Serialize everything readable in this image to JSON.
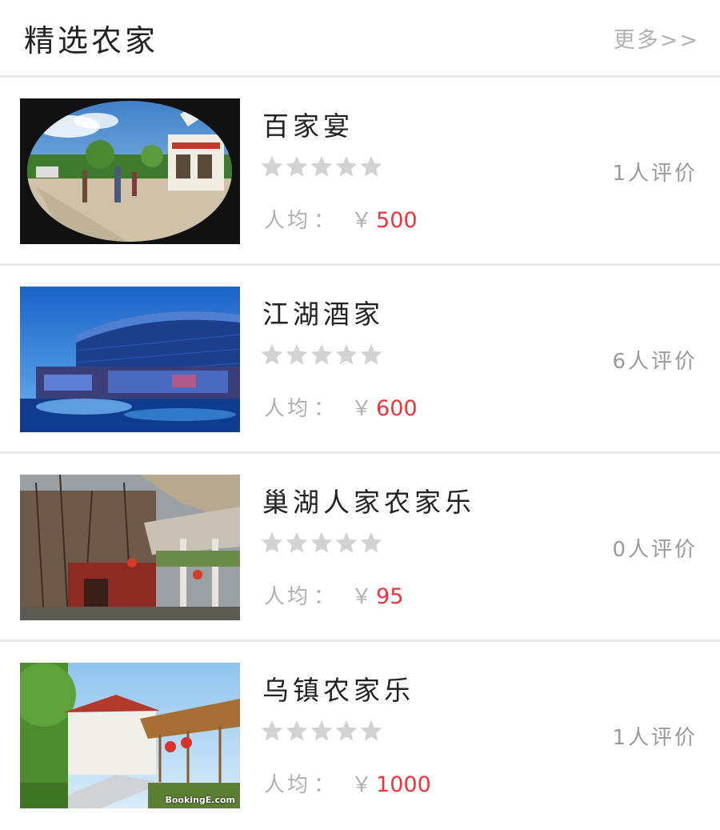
{
  "header": {
    "title": "精选农家",
    "more": "更多>>"
  },
  "labels": {
    "avg_prefix": "人均",
    "avg_sep": "：",
    "currency": "￥"
  },
  "colors": {
    "star": "#d2d2d2",
    "price": "#f0333c",
    "divider": "#e9e9e9"
  },
  "items": [
    {
      "name": "百家宴",
      "rating": 0,
      "reviews": "1人评价",
      "price": "500",
      "watermark": ""
    },
    {
      "name": "江湖酒家",
      "rating": 0,
      "reviews": "6人评价",
      "price": "600",
      "watermark": ""
    },
    {
      "name": "巢湖人家农家乐",
      "rating": 0,
      "reviews": "0人评价",
      "price": "95",
      "watermark": ""
    },
    {
      "name": "乌镇农家乐",
      "rating": 0,
      "reviews": "1人评价",
      "price": "1000",
      "watermark": "BookingE.com"
    }
  ]
}
